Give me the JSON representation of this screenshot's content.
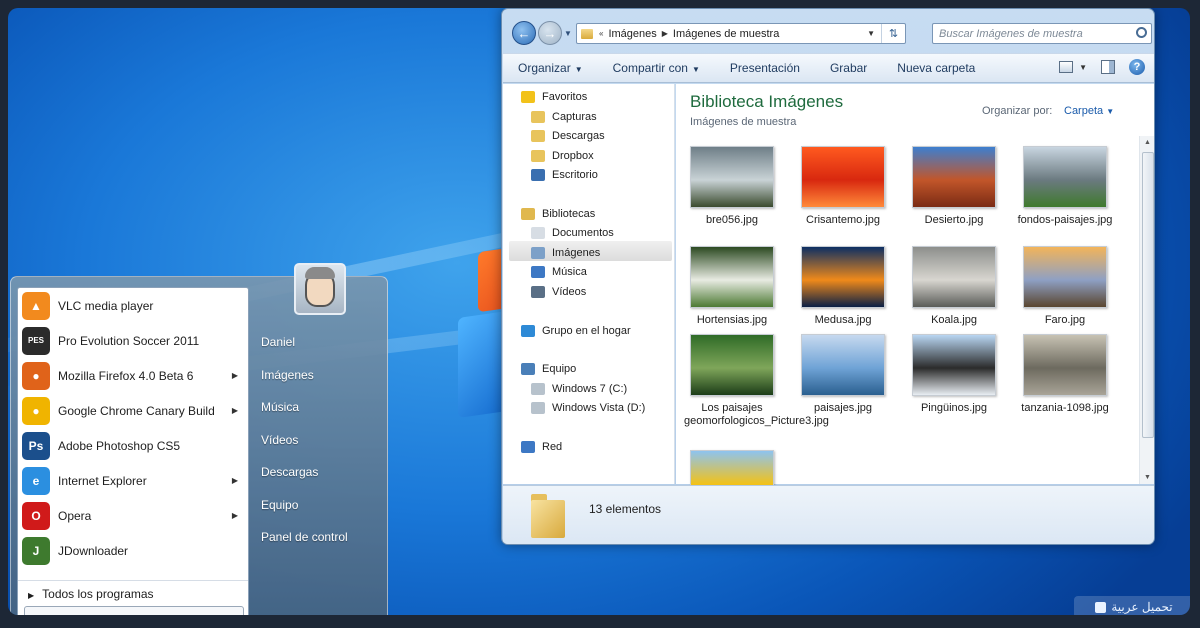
{
  "start_menu": {
    "programs": [
      {
        "label": "VLC media player",
        "icon": "vlc-icon",
        "color": "#f28a1e",
        "arrow": false
      },
      {
        "label": "Pro Evolution Soccer 2011",
        "icon": "pes-icon",
        "color": "#2b2b2b",
        "arrow": false
      },
      {
        "label": "Mozilla Firefox 4.0 Beta 6",
        "icon": "firefox-icon",
        "color": "#e0631a",
        "arrow": true
      },
      {
        "label": "Google Chrome Canary Build",
        "icon": "chrome-canary-icon",
        "color": "#f0b400",
        "arrow": true
      },
      {
        "label": "Adobe Photoshop CS5",
        "icon": "photoshop-icon",
        "color": "#1b4f8c",
        "arrow": false
      },
      {
        "label": "Internet Explorer",
        "icon": "ie-icon",
        "color": "#2b8fe0",
        "arrow": true
      },
      {
        "label": "Opera",
        "icon": "opera-icon",
        "color": "#d01a1a",
        "arrow": true
      },
      {
        "label": "JDownloader",
        "icon": "jdownloader-icon",
        "color": "#3e7a2e",
        "arrow": false
      }
    ],
    "all_programs": "Todos los programas",
    "places": [
      "Daniel",
      "Imágenes",
      "Música",
      "Vídeos",
      "Descargas",
      "Equipo",
      "Panel de control"
    ]
  },
  "explorer": {
    "breadcrumb": [
      "Imágenes",
      "Imágenes de muestra"
    ],
    "search_placeholder": "Buscar Imágenes de muestra",
    "toolbar": {
      "organize": "Organizar",
      "share": "Compartir con",
      "slideshow": "Presentación",
      "burn": "Grabar",
      "new_folder": "Nueva carpeta"
    },
    "nav": {
      "favorites": "Favoritos",
      "favorites_items": [
        "Capturas",
        "Descargas",
        "Dropbox",
        "Escritorio"
      ],
      "libraries": "Bibliotecas",
      "library_items": [
        "Documentos",
        "Imágenes",
        "Música",
        "Vídeos"
      ],
      "homegroup": "Grupo en el hogar",
      "computer": "Equipo",
      "drives": [
        "Windows 7 (C:)",
        "Windows Vista (D:)"
      ],
      "network": "Red",
      "selected": "Imágenes"
    },
    "library_title": "Biblioteca Imágenes",
    "library_subtitle": "Imágenes de muestra",
    "arrange_label": "Organizar por:",
    "arrange_value": "Carpeta",
    "files": [
      {
        "name": "bre056.jpg",
        "colors": [
          "#6f7f88",
          "#c9d3d6",
          "#3b4b2e"
        ]
      },
      {
        "name": "Crisantemo.jpg",
        "colors": [
          "#ff5a1f",
          "#d8280f",
          "#ff8a3a"
        ]
      },
      {
        "name": "Desierto.jpg",
        "colors": [
          "#3d7fd0",
          "#c2562a",
          "#7a2b14"
        ]
      },
      {
        "name": "fondos-paisajes.jpg",
        "colors": [
          "#c8d5e0",
          "#6b7a80",
          "#3f7a2c"
        ]
      },
      {
        "name": "Hortensias.jpg",
        "colors": [
          "#2c4a22",
          "#e8ebe2",
          "#4d7a34"
        ]
      },
      {
        "name": "Medusa.jpg",
        "colors": [
          "#0d2f63",
          "#f08a1a",
          "#0a1f45"
        ]
      },
      {
        "name": "Koala.jpg",
        "colors": [
          "#8d8f8c",
          "#d8d6d0",
          "#5a5c58"
        ]
      },
      {
        "name": "Faro.jpg",
        "colors": [
          "#f2b45a",
          "#8ea0c4",
          "#5a4630"
        ]
      },
      {
        "name": "Los paisajes geomorfologicos_Picture3.jpg",
        "colors": [
          "#2f6b27",
          "#7fa65a",
          "#1c3d18"
        ]
      },
      {
        "name": "paisajes.jpg",
        "colors": [
          "#c6d9ef",
          "#6fa3d6",
          "#2a5f8f"
        ]
      },
      {
        "name": "Pingüinos.jpg",
        "colors": [
          "#b9d6f2",
          "#2b2b2b",
          "#e9eef3"
        ]
      },
      {
        "name": "tanzania-1098.jpg",
        "colors": [
          "#c7c2b3",
          "#6d6a5f",
          "#a9a497"
        ]
      },
      {
        "name": "",
        "colors": [
          "#8ec3ef",
          "#f2c21a",
          "#d9a10a"
        ]
      }
    ],
    "item_count": "13 elementos"
  },
  "watermark": "تحميل عربية"
}
